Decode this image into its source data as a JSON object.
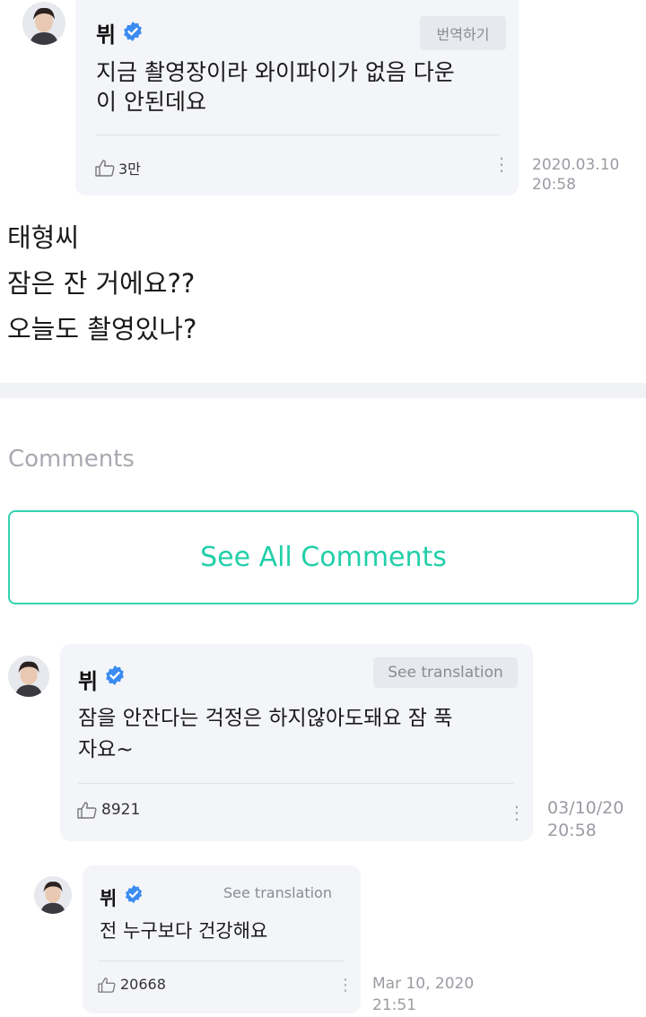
{
  "post_card": {
    "author": "뷔",
    "translate_label": "번역하기",
    "text": "지금 촬영장이라 와이파이가 없음 다운\n이 안된데요",
    "likes": "3만",
    "timestamp": "2020.03.10\n20:58"
  },
  "fan_post": {
    "lines": [
      "태형씨",
      "잠은 잔 거에요??",
      "오늘도 촬영있나?"
    ]
  },
  "comments_section": {
    "title": "Comments",
    "see_all_label": "See All Comments"
  },
  "comment_1": {
    "author": "뷔",
    "translate_label": "See translation",
    "text": "잠을 안잔다는 걱정은 하지않아도돼요 잠 푹\n자요~",
    "likes": "8921",
    "timestamp": "03/10/20\n20:58"
  },
  "comment_2": {
    "author": "뷔",
    "translate_label": "See translation",
    "text": "전 누구보다 건강해요",
    "likes": "20668",
    "timestamp": "Mar 10, 2020\n21:51"
  },
  "colors": {
    "accent": "#22cfa9",
    "verified": "#3b8cf0",
    "bubble": "#f4f5f9"
  }
}
